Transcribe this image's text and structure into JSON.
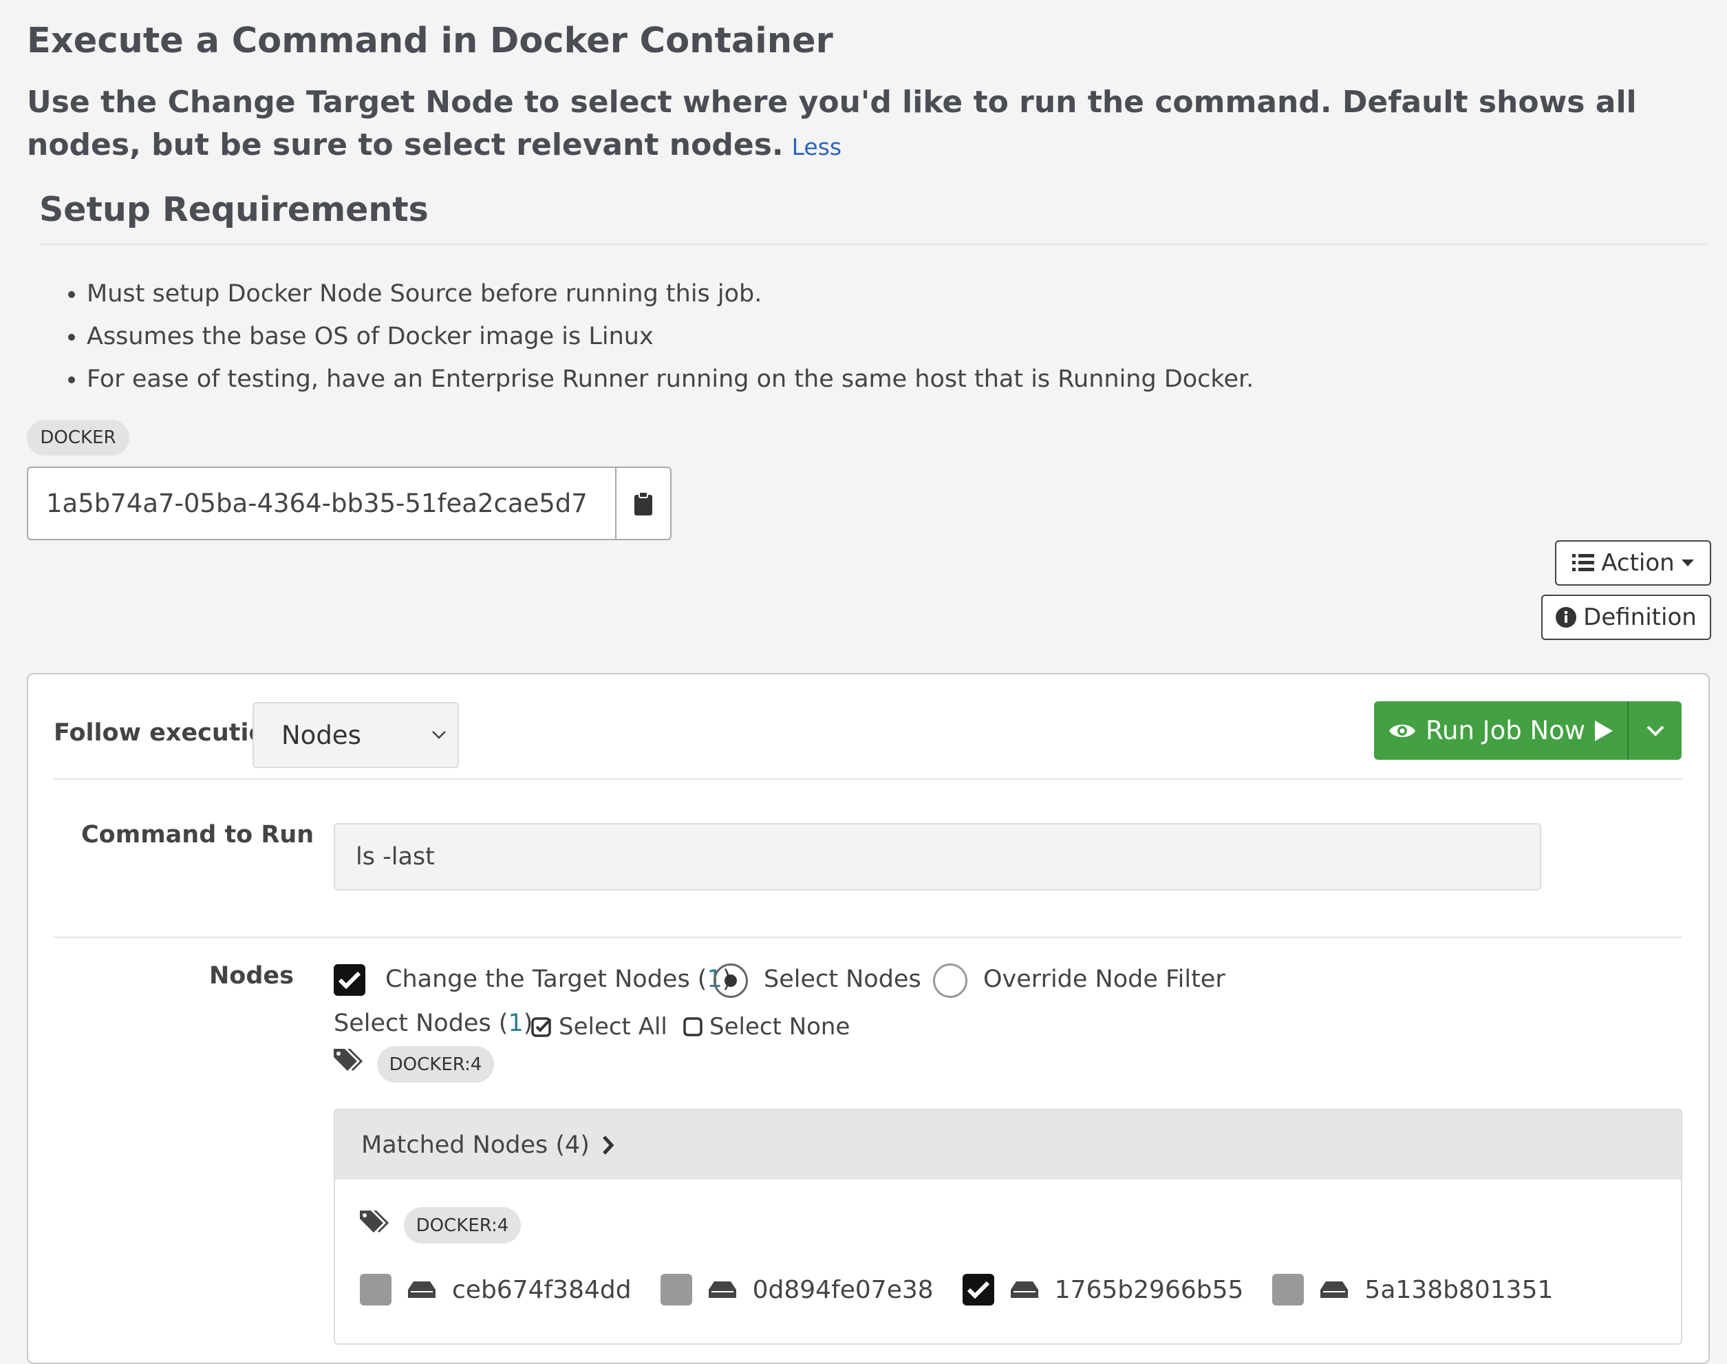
{
  "page": {
    "title": "Execute a Command in Docker Container",
    "description": "Use the Change Target Node to select where you'd like to run the command. Default shows all nodes, but be sure to select relevant nodes.",
    "less_link": "Less"
  },
  "setup": {
    "heading": "Setup Requirements",
    "items": [
      "Must setup Docker Node Source before running this job.",
      "Assumes the base OS of Docker image is Linux",
      "For ease of testing, have an Enterprise Runner running on the same host that is Running Docker."
    ]
  },
  "tag": "DOCKER",
  "job_uuid": "1a5b74a7-05ba-4364-bb35-51fea2cae5d7",
  "actions": {
    "action_label": "Action",
    "definition_label": "Definition"
  },
  "run_panel": {
    "follow_label": "Follow execution",
    "follow_value": "Nodes",
    "run_button": "Run Job Now",
    "command_label": "Command to Run",
    "command_value": "ls -last",
    "nodes_label": "Nodes",
    "change_target_label": "Change the Target Nodes (",
    "change_target_count": "1",
    "radio_select_nodes": "Select Nodes",
    "radio_override": "Override Node Filter",
    "select_nodes_label": "Select Nodes (",
    "select_nodes_count": "1",
    "select_all": "Select All",
    "select_none": "Select None",
    "filter_tag": "DOCKER:4",
    "matched_label": "Matched Nodes (4)",
    "matched_tag": "DOCKER:4",
    "nodes": [
      {
        "name": "ceb674f384dd",
        "checked": false
      },
      {
        "name": "0d894fe07e38",
        "checked": false
      },
      {
        "name": "1765b2966b55",
        "checked": true
      },
      {
        "name": "5a138b801351",
        "checked": false
      }
    ]
  },
  "colors": {
    "run_button": "#43a143",
    "link": "#2b63b9",
    "count": "#2a7d8b"
  }
}
